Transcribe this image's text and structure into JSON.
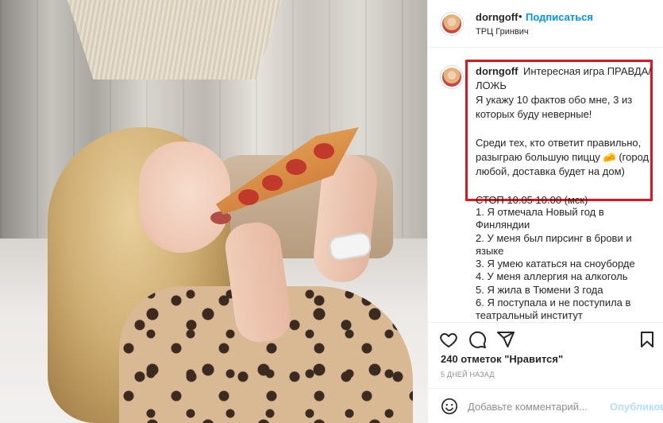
{
  "post": {
    "username": "dorngoff",
    "follow_label": "Подписаться",
    "dot": "•",
    "location": "ТРЦ Гринвич"
  },
  "caption": {
    "username": "dorngoff",
    "line1": "Интересная игра ПРАВДА/ЛОЖЬ",
    "line2": "Я укажу 10 фактов обо мне, 3 из которых буду неверные!",
    "line3": "Среди тех, кто ответит правильно, разыграю большую пиццу 🧀 (город любой, доставка будет на дом)",
    "line4": "СТОП 10.05 10.00 (мск)"
  },
  "facts": [
    "1. Я отмечала Новый год в Финляндии",
    "2. У меня был пирсинг в брови и языке",
    "3. Я умею кататься на сноуборде",
    "4. У меня аллергия на алкоголь",
    "5. Я жила в Тюмени 3 года",
    "6. Я поступала и не поступила в театральный институт"
  ],
  "actions": {
    "icons": [
      "heart-icon",
      "comment-icon",
      "share-icon",
      "bookmark-icon"
    ]
  },
  "likes": {
    "count": "240 отметок",
    "suffix": "\"Нравится\""
  },
  "timestamp": "5 ДНЕЙ НАЗАД",
  "composer": {
    "placeholder": "Добавьте комментарий...",
    "publish_label": "Опубликовать"
  },
  "colors": {
    "link": "#0095f6",
    "highlight": "#e2141f",
    "publish_disabled": "#b2dffc"
  }
}
